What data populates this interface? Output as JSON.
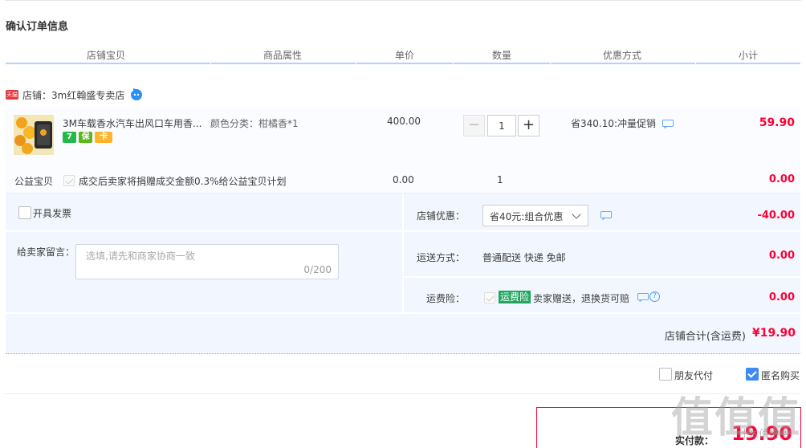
{
  "section_title": "确认订单信息",
  "table_headers": [
    "店铺宝贝",
    "商品属性",
    "单价",
    "数量",
    "优惠方式",
    "小计"
  ],
  "shop": {
    "badge": "天猫",
    "label": "店铺：3m红翰盛专卖店"
  },
  "item": {
    "title": "3M车载香水汽车出风口车用香...",
    "attribute": "颜色分类：柑橘香*1",
    "price": "400.00",
    "quantity": "1",
    "minus": "−",
    "plus": "+",
    "promotion": "省340.10:冲量促销",
    "subtotal": "59.90",
    "service_icons": [
      "7",
      "保",
      "卡"
    ],
    "service_colors": [
      "#24b84a",
      "#59b81b",
      "#ffb52b"
    ]
  },
  "charity": {
    "label": "公益宝贝",
    "text": "成交后卖家将捐赠成交金额0.3%给公益宝贝计划",
    "price": "0.00",
    "quantity": "1",
    "subtotal": "0.00"
  },
  "order": {
    "invoice_label": "开具发票",
    "memo_label": "给卖家留言：",
    "memo_placeholder": "选填,请先和商家协商一致",
    "memo_count": "0/200",
    "shop_discount_label": "店铺优惠：",
    "shop_discount_selected": "省40元:组合优惠",
    "shop_discount_value": "-40.00",
    "shipping_label": "运送方式：",
    "shipping_value": "普通配送 快递 免邮",
    "shipping_cost": "0.00",
    "insurance_label": "运费险：",
    "insurance_badge": "运费险",
    "insurance_text": "卖家赠送，退换货可赔",
    "insurance_cost": "0.00",
    "help_glyph": "?",
    "shop_total_label": "店铺合计(含运费)",
    "shop_total_value": "¥19.90"
  },
  "options": {
    "friend_pay_label": "朋友代付",
    "friend_pay_checked": false,
    "anonymous_label": "匿名购买",
    "anonymous_checked": true
  },
  "payment": {
    "label": "实付款：",
    "value": "19.90"
  },
  "watermark": {
    "logo": "值值值",
    "site": "什么值得买"
  },
  "colors": {
    "accent_red": "#ff0036",
    "header_line": "#b2d1ff",
    "order_bg": "#f2f7ff",
    "checkbox_blue": "#3d8af7"
  }
}
